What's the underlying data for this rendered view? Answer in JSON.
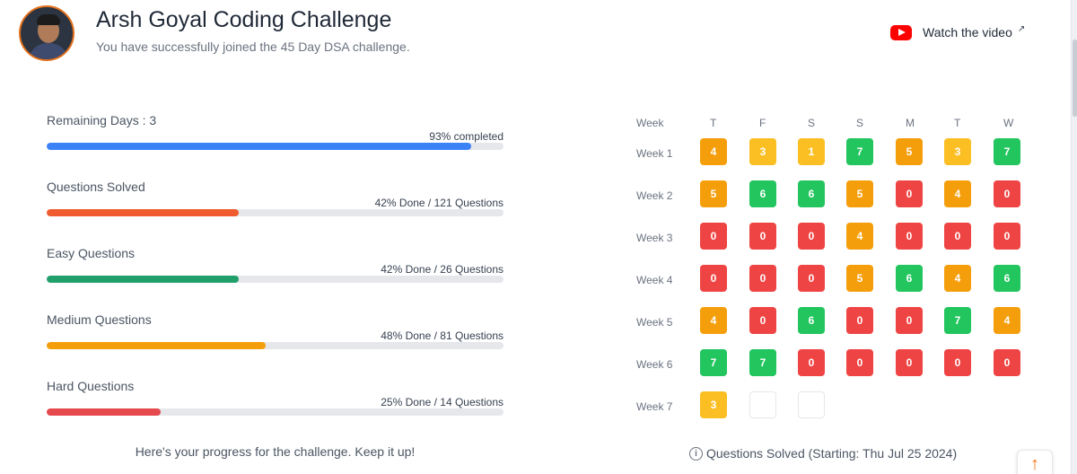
{
  "header": {
    "title": "Arsh Goyal Coding Challenge",
    "subtitle": "You have successfully joined the 45 Day DSA challenge.",
    "watch_label": "Watch the video",
    "watch_icon": "youtube-icon",
    "external_icon": "external-link-icon"
  },
  "progress": {
    "metrics": [
      {
        "label": "Remaining Days : 3",
        "value": "93% completed",
        "percent": 93,
        "color": "#3b82f6"
      },
      {
        "label": "Questions Solved",
        "value": "42% Done / 121 Questions",
        "percent": 42,
        "color": "#ef5b2e"
      },
      {
        "label": "Easy Questions",
        "value": "42% Done / 26 Questions",
        "percent": 42,
        "color": "#22a06b"
      },
      {
        "label": "Medium Questions",
        "value": "48% Done / 81 Questions",
        "percent": 48,
        "color": "#f59e0b"
      },
      {
        "label": "Hard Questions",
        "value": "25% Done / 14 Questions",
        "percent": 25,
        "color": "#e5484d"
      }
    ],
    "footer": "Here's your progress for the challenge. Keep it up!"
  },
  "grid": {
    "header": {
      "week": "Week",
      "days": [
        "T",
        "F",
        "S",
        "S",
        "M",
        "T",
        "W"
      ]
    },
    "rows": [
      {
        "label": "Week 1",
        "values": [
          "4",
          "3",
          "1",
          "7",
          "5",
          "3",
          "7"
        ],
        "colors": [
          "orange",
          "yellow",
          "yellow",
          "green",
          "orange",
          "yellow",
          "green"
        ]
      },
      {
        "label": "Week 2",
        "values": [
          "5",
          "6",
          "6",
          "5",
          "0",
          "4",
          "0"
        ],
        "colors": [
          "orange",
          "green",
          "green",
          "orange",
          "red",
          "orange",
          "red"
        ]
      },
      {
        "label": "Week 3",
        "values": [
          "0",
          "0",
          "0",
          "4",
          "0",
          "0",
          "0"
        ],
        "colors": [
          "red",
          "red",
          "red",
          "orange",
          "red",
          "red",
          "red"
        ]
      },
      {
        "label": "Week 4",
        "values": [
          "0",
          "0",
          "0",
          "5",
          "6",
          "4",
          "6"
        ],
        "colors": [
          "red",
          "red",
          "red",
          "orange",
          "green",
          "orange",
          "green"
        ]
      },
      {
        "label": "Week 5",
        "values": [
          "4",
          "0",
          "6",
          "0",
          "0",
          "7",
          "4"
        ],
        "colors": [
          "orange",
          "red",
          "green",
          "red",
          "red",
          "green",
          "orange"
        ]
      },
      {
        "label": "Week 6",
        "values": [
          "7",
          "7",
          "0",
          "0",
          "0",
          "0",
          "0"
        ],
        "colors": [
          "green",
          "green",
          "red",
          "red",
          "red",
          "red",
          "red"
        ]
      },
      {
        "label": "Week 7",
        "values": [
          "3",
          "",
          ""
        ],
        "colors": [
          "yellow",
          "empty",
          "empty"
        ]
      }
    ],
    "palette": {
      "green": "#22c55e",
      "red": "#ef4444",
      "orange": "#f59e0b",
      "yellow": "#fbbf24"
    },
    "footer": "Questions Solved (Starting: Thu Jul 25 2024)",
    "info_icon": "info-icon"
  },
  "scroll_top_icon": "arrow-up-icon"
}
